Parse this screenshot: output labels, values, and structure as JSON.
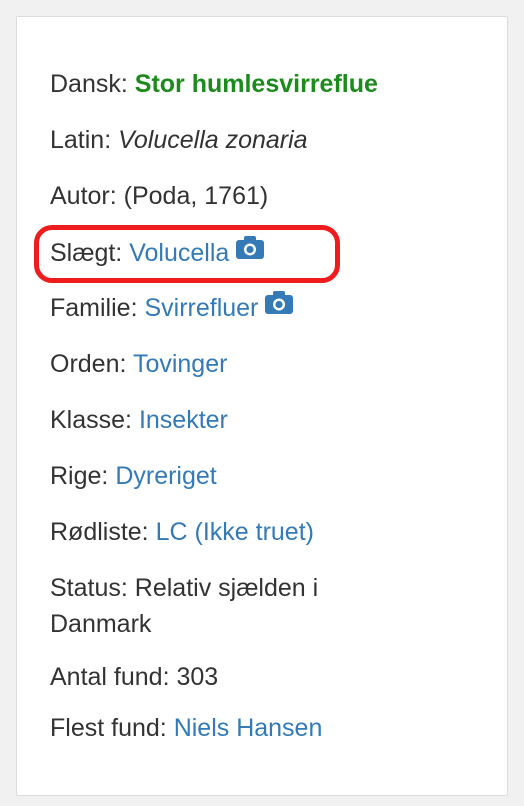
{
  "species": {
    "dansk": {
      "label": "Dansk:",
      "value": "Stor humlesvirreflue"
    },
    "latin": {
      "label": "Latin:",
      "value": "Volucella zonaria"
    },
    "autor": {
      "label": "Autor:",
      "value": "(Poda, 1761)"
    },
    "slaegt": {
      "label": "Slægt:",
      "value": "Volucella",
      "icon": "camera-icon"
    },
    "familie": {
      "label": "Familie:",
      "value": "Svirrefluer",
      "icon": "camera-icon"
    },
    "orden": {
      "label": "Orden:",
      "value": "Tovinger"
    },
    "klasse": {
      "label": "Klasse:",
      "value": "Insekter"
    },
    "rige": {
      "label": "Rige:",
      "value": "Dyreriget"
    },
    "roedliste": {
      "label": "Rødliste:",
      "value": "LC (Ikke truet)"
    },
    "status": {
      "label": "Status:",
      "value": "Relativ sjælden i Danmark"
    },
    "antal_fund": {
      "label": "Antal fund:",
      "value": "303"
    },
    "flest_fund": {
      "label": "Flest fund:",
      "value": "Niels Hansen"
    }
  },
  "colors": {
    "link": "#337ab7",
    "danish_name": "#1c8a1c",
    "highlight": "#ee1c1c"
  }
}
